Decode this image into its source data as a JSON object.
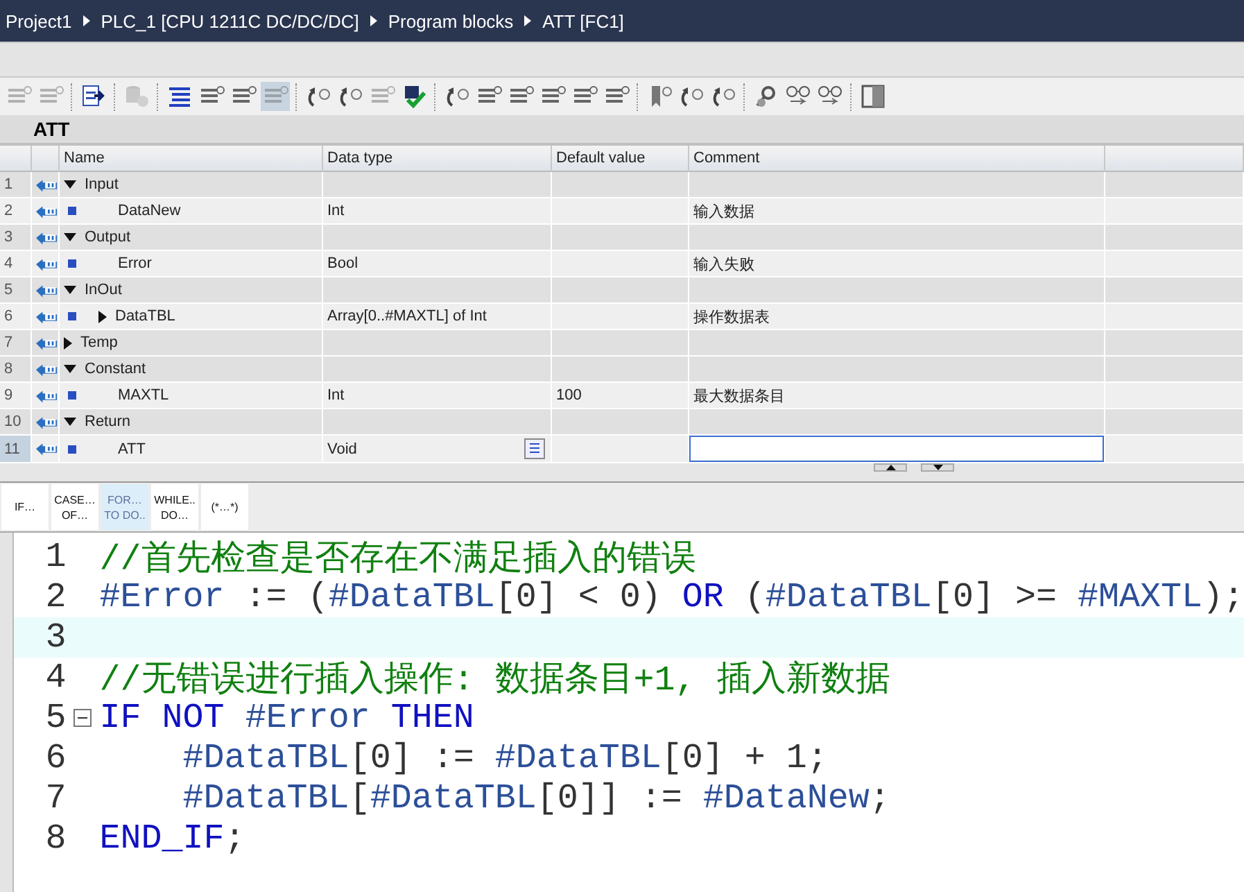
{
  "breadcrumb": [
    "Project1",
    "PLC_1 [CPU 1211C DC/DC/DC]",
    "Program blocks",
    "ATT [FC1]"
  ],
  "toolbar": [
    {
      "kind": "lines",
      "disabled": true,
      "selected": false
    },
    {
      "kind": "lines",
      "disabled": true,
      "selected": false
    },
    {
      "kind": "separator"
    },
    {
      "kind": "doc-arrow",
      "disabled": false,
      "selected": false
    },
    {
      "kind": "separator"
    },
    {
      "kind": "cylinder",
      "disabled": true,
      "selected": false
    },
    {
      "kind": "separator"
    },
    {
      "kind": "list",
      "disabled": false,
      "selected": false
    },
    {
      "kind": "lines",
      "disabled": false,
      "selected": false
    },
    {
      "kind": "lines",
      "disabled": false,
      "selected": false
    },
    {
      "kind": "lines",
      "disabled": true,
      "selected": true
    },
    {
      "kind": "separator"
    },
    {
      "kind": "curved-arrow",
      "disabled": false,
      "selected": false
    },
    {
      "kind": "curved-arrow",
      "disabled": false,
      "selected": false
    },
    {
      "kind": "lines",
      "disabled": true,
      "selected": false
    },
    {
      "kind": "check",
      "disabled": false,
      "selected": false
    },
    {
      "kind": "separator"
    },
    {
      "kind": "curved-arrow",
      "disabled": false,
      "selected": false
    },
    {
      "kind": "lines",
      "disabled": false,
      "selected": false
    },
    {
      "kind": "lines",
      "disabled": false,
      "selected": false
    },
    {
      "kind": "lines",
      "disabled": false,
      "selected": false
    },
    {
      "kind": "lines",
      "disabled": false,
      "selected": false
    },
    {
      "kind": "lines",
      "disabled": false,
      "selected": false
    },
    {
      "kind": "separator"
    },
    {
      "kind": "bookmark",
      "disabled": false,
      "selected": false
    },
    {
      "kind": "curved-arrow",
      "disabled": false,
      "selected": false
    },
    {
      "kind": "curved-arrow",
      "disabled": false,
      "selected": false
    },
    {
      "kind": "separator"
    },
    {
      "kind": "magnifier",
      "disabled": false,
      "selected": false
    },
    {
      "kind": "glasses",
      "disabled": false,
      "selected": false
    },
    {
      "kind": "glasses",
      "disabled": false,
      "selected": false
    },
    {
      "kind": "separator"
    },
    {
      "kind": "panel",
      "disabled": false,
      "selected": false
    }
  ],
  "interface": {
    "title": "ATT",
    "columns": [
      "Name",
      "Data type",
      "Default value",
      "Comment"
    ],
    "sections": [
      {
        "number": "1",
        "name": "Input",
        "expanded": true,
        "selected": false,
        "children": [
          {
            "number": "2",
            "name": "DataNew",
            "data_type": "Int",
            "comment": "输入数据",
            "selected": false
          }
        ]
      },
      {
        "number": "3",
        "name": "Output",
        "expanded": true,
        "selected": false,
        "children": [
          {
            "number": "4",
            "name": "Error",
            "data_type": "Bool",
            "comment": "输入失败",
            "selected": false
          }
        ]
      },
      {
        "number": "5",
        "name": "InOut",
        "expanded": true,
        "selected": false,
        "children": [
          {
            "number": "6",
            "name": "DataTBL",
            "expanded": false,
            "data_type": "Array[0..#MAXTL] of Int",
            "comment": "操作数据表",
            "selected": false
          }
        ]
      },
      {
        "number": "7",
        "name": "Temp",
        "expanded": false,
        "selected": false
      },
      {
        "number": "8",
        "name": "Constant",
        "expanded": true,
        "selected": false,
        "children": [
          {
            "number": "9",
            "name": "MAXTL",
            "data_type": "Int",
            "default_value": "100",
            "comment": "最大数据条目",
            "selected": false
          }
        ]
      },
      {
        "number": "10",
        "name": "Return",
        "expanded": true,
        "selected": false,
        "children": [
          {
            "number": "11",
            "name": "ATT",
            "data_type": "Void",
            "selected": true
          }
        ]
      }
    ]
  },
  "snippets": [
    {
      "lines": [
        "IF…"
      ],
      "selected": false
    },
    {
      "lines": [
        "CASE…",
        "OF…"
      ],
      "selected": false
    },
    {
      "lines": [
        "FOR…",
        "TO DO.."
      ],
      "selected": true
    },
    {
      "lines": [
        "WHILE..",
        "DO…"
      ],
      "selected": false
    },
    {
      "lines": [
        "(*…*)"
      ],
      "selected": false
    }
  ],
  "code": [
    {
      "number": "1",
      "current": false,
      "fold": false,
      "tokens": [
        {
          "kind": "comment",
          "text": "//首先检查是否存在不满足插入的错误"
        }
      ]
    },
    {
      "number": "2",
      "current": false,
      "fold": false,
      "tokens": [
        {
          "kind": "var",
          "text": "#Error"
        },
        {
          "kind": "plain",
          "text": " := ("
        },
        {
          "kind": "var",
          "text": "#DataTBL"
        },
        {
          "kind": "plain",
          "text": "[0] < 0) "
        },
        {
          "kind": "keyword",
          "text": "OR"
        },
        {
          "kind": "plain",
          "text": " ("
        },
        {
          "kind": "var",
          "text": "#DataTBL"
        },
        {
          "kind": "plain",
          "text": "[0] >= "
        },
        {
          "kind": "var",
          "text": "#MAXTL"
        },
        {
          "kind": "plain",
          "text": ");"
        }
      ]
    },
    {
      "number": "3",
      "current": true,
      "fold": false
    },
    {
      "number": "4",
      "current": false,
      "fold": false,
      "tokens": [
        {
          "kind": "comment",
          "text": "//无错误进行插入操作: 数据条目+1, 插入新数据"
        }
      ]
    },
    {
      "number": "5",
      "current": false,
      "fold": true,
      "tokens": [
        {
          "kind": "keyword",
          "text": "IF NOT "
        },
        {
          "kind": "var",
          "text": "#Error"
        },
        {
          "kind": "keyword",
          "text": " THEN"
        }
      ]
    },
    {
      "number": "6",
      "current": false,
      "fold": false,
      "tokens": [
        {
          "kind": "var",
          "text": "    #DataTBL"
        },
        {
          "kind": "plain",
          "text": "[0] := "
        },
        {
          "kind": "var",
          "text": "#DataTBL"
        },
        {
          "kind": "plain",
          "text": "[0] + 1;"
        }
      ]
    },
    {
      "number": "7",
      "current": false,
      "fold": false,
      "tokens": [
        {
          "kind": "var",
          "text": "    #DataTBL"
        },
        {
          "kind": "plain",
          "text": "["
        },
        {
          "kind": "var",
          "text": "#DataTBL"
        },
        {
          "kind": "plain",
          "text": "[0]] := "
        },
        {
          "kind": "var",
          "text": "#DataNew"
        },
        {
          "kind": "plain",
          "text": ";"
        }
      ]
    },
    {
      "number": "8",
      "current": false,
      "fold": false,
      "tokens": [
        {
          "kind": "keyword",
          "text": "END_IF"
        },
        {
          "kind": "plain",
          "text": ";"
        }
      ]
    }
  ]
}
